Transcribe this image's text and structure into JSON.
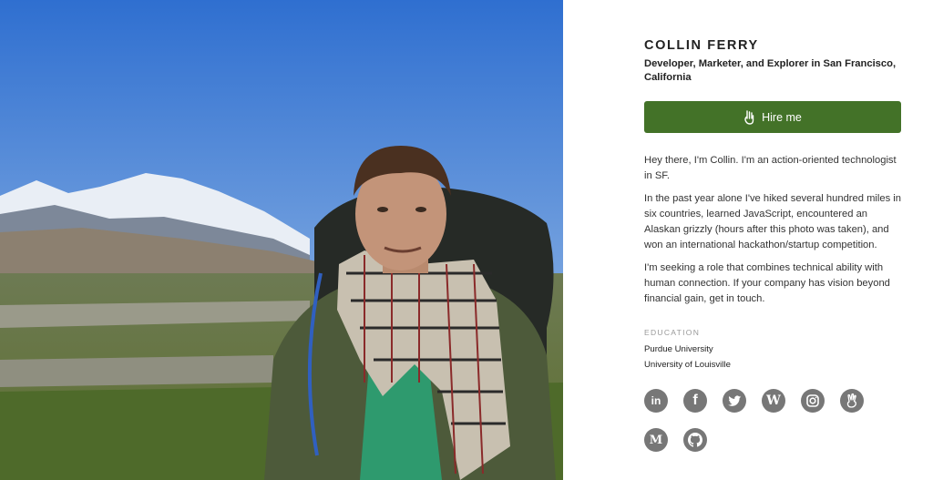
{
  "profile": {
    "name": "COLLIN FERRY",
    "tagline": "Developer, Marketer, and Explorer in San Francisco, California",
    "hire_label": "Hire me"
  },
  "bio": [
    "Hey there, I'm Collin. I'm an action-oriented technologist in SF.",
    "In the past year alone I've hiked several hundred miles in six countries, learned JavaScript, encountered an Alaskan grizzly (hours after this photo was taken), and won an international hackathon/startup competition.",
    "I'm seeking a role that combines technical ability with human connection. If your company has vision beyond financial gain, get in touch."
  ],
  "education": {
    "heading": "EDUCATION",
    "schools": [
      "Purdue University",
      "University of Louisville"
    ]
  },
  "social_icons": [
    "linkedin-icon",
    "facebook-icon",
    "twitter-icon",
    "wordpress-icon",
    "instagram-icon",
    "angellist-icon",
    "medium-icon",
    "github-icon"
  ],
  "social_letters": {
    "linkedin": "in",
    "facebook": "f",
    "wordpress": "W",
    "medium": "M"
  },
  "colors": {
    "hire_button": "#437228",
    "icon_gray": "#777777",
    "sky": "#3f7fcf"
  }
}
